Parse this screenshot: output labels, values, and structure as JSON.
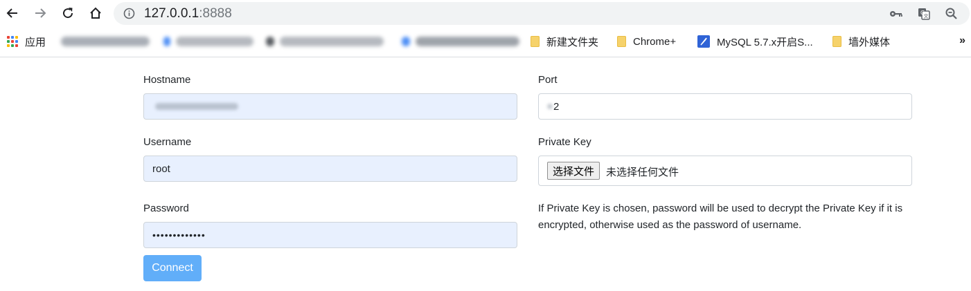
{
  "browser": {
    "url_host": "127.0.0.1",
    "url_port": ":8888",
    "icons": [
      "back-icon",
      "forward-icon",
      "reload-icon",
      "home-icon",
      "info-icon",
      "key-icon",
      "translate-icon",
      "zoom-icon"
    ]
  },
  "bookmarks": {
    "apps_label": "应用",
    "items": [
      {
        "label": "新建文件夹",
        "icon": "folder-icon"
      },
      {
        "label": "Chrome+",
        "icon": "folder-icon"
      },
      {
        "label": "MySQL 5.7.x开启S...",
        "icon": "feather-icon"
      },
      {
        "label": "墙外媒体",
        "icon": "folder-icon"
      }
    ],
    "more_label": "»"
  },
  "form": {
    "hostname_label": "Hostname",
    "port_label": "Port",
    "port_value": "2",
    "username_label": "Username",
    "username_value": "root",
    "private_key_label": "Private Key",
    "file_button_label": "选择文件",
    "file_status": "未选择任何文件",
    "password_label": "Password",
    "password_value": "•••••••••••••",
    "help_text": "If Private Key is chosen, password will be used to decrypt the Private Key if it is encrypted, otherwise used as the password of username.",
    "connect_label": "Connect"
  },
  "colors": {
    "autofill_bg": "#e8f0fe",
    "connect_bg": "#61aef9",
    "folder": "#f6d26b"
  }
}
